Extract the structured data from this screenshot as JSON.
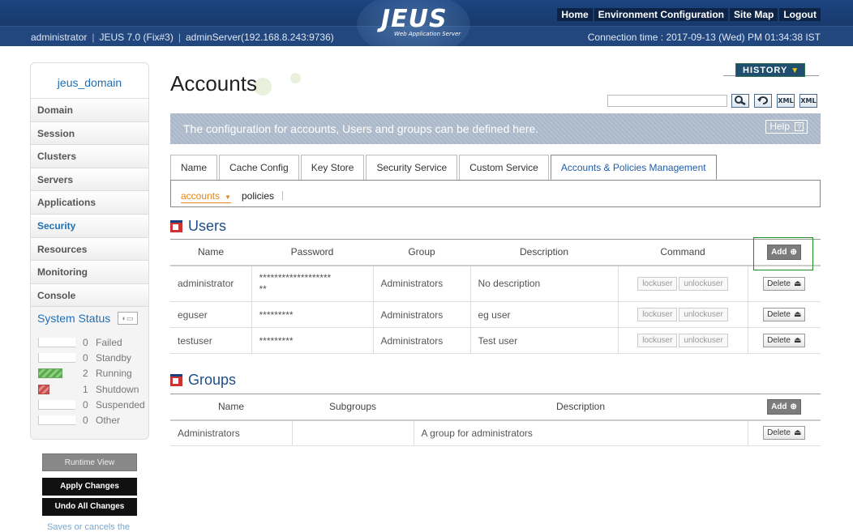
{
  "header": {
    "logo": "JEUS",
    "logo_sub": "Web Application Server",
    "nav": [
      "Home",
      "Environment Configuration",
      "Site Map",
      "Logout"
    ],
    "user": "administrator",
    "version": "JEUS 7.0 (Fix#3)",
    "server": "adminServer(192.168.8.243:9736)",
    "connection_time": "Connection time : 2017-09-13 (Wed) PM 01:34:38 IST"
  },
  "sidebar": {
    "domain": "jeus_domain",
    "items": [
      "Domain",
      "Session",
      "Clusters",
      "Servers",
      "Applications",
      "Security",
      "Resources",
      "Monitoring",
      "Console"
    ],
    "active": "Security",
    "system_status_title": "System Status",
    "status": [
      {
        "count": "0",
        "label": "Failed"
      },
      {
        "count": "0",
        "label": "Standby"
      },
      {
        "count": "2",
        "label": "Running"
      },
      {
        "count": "1",
        "label": "Shutdown"
      },
      {
        "count": "0",
        "label": "Suspended"
      },
      {
        "count": "0",
        "label": "Other"
      }
    ],
    "buttons": {
      "runtime_view": "Runtime View",
      "apply": "Apply Changes",
      "undo": "Undo All Changes"
    },
    "note": "Saves or cancels the"
  },
  "main": {
    "title": "Accounts",
    "history": "HISTORY",
    "banner": "The configuration for accounts, Users and groups can be defined here.",
    "help": "Help",
    "tools": [
      "search-icon",
      "refresh-icon",
      "xml-export-icon",
      "xml-import-icon"
    ],
    "tool_labels": [
      "",
      "",
      "XML",
      "XML"
    ],
    "tabs": [
      "Name",
      "Cache Config",
      "Key Store",
      "Security Service",
      "Custom Service",
      "Accounts & Policies Management"
    ],
    "active_tab": "Accounts & Policies Management",
    "subtabs": {
      "accounts": "accounts",
      "policies": "policies"
    }
  },
  "users": {
    "title": "Users",
    "columns": [
      "Name",
      "Password",
      "Group",
      "Description",
      "Command"
    ],
    "add": "Add",
    "rows": [
      {
        "name": "administrator",
        "password_line1": "*******************",
        "password_line2": "**",
        "group": "Administrators",
        "description": "No description"
      },
      {
        "name": "eguser",
        "password_line1": "*********",
        "password_line2": "",
        "group": "Administrators",
        "description": "eg user"
      },
      {
        "name": "testuser",
        "password_line1": "*********",
        "password_line2": "",
        "group": "Administrators",
        "description": "Test user"
      }
    ],
    "lock": "lockuser",
    "unlock": "unlockuser",
    "delete": "Delete"
  },
  "groups": {
    "title": "Groups",
    "columns": [
      "Name",
      "Subgroups",
      "Description"
    ],
    "add": "Add",
    "rows": [
      {
        "name": "Administrators",
        "subgroups": "",
        "description": "A group for administrators"
      }
    ],
    "delete": "Delete"
  }
}
